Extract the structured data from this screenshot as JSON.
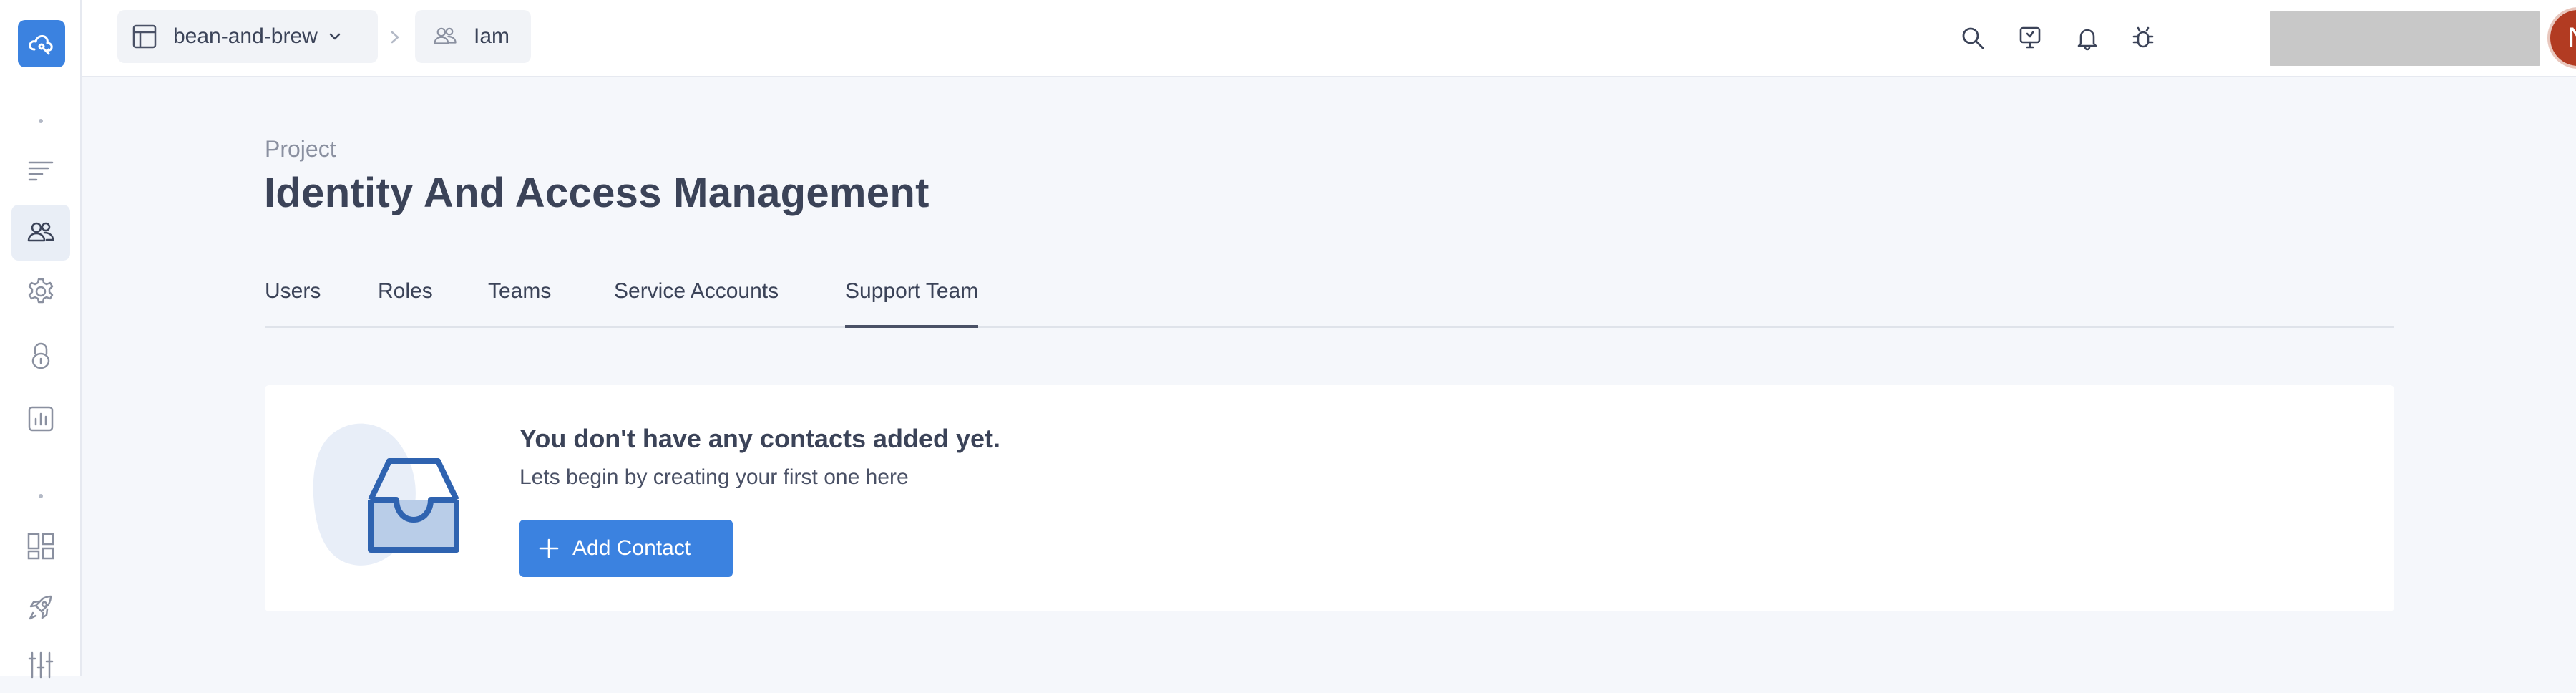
{
  "breadcrumb": {
    "project": "bean-and-brew",
    "section": "Iam"
  },
  "header": {
    "icons": [
      "search-icon",
      "screen-share-icon",
      "bell-icon",
      "bug-icon"
    ],
    "avatar_initial": "N"
  },
  "sidebar": {
    "icons": [
      "logo-icon",
      "list-icon",
      "users-icon",
      "gear-icon",
      "lock-icon",
      "chart-icon",
      "widgets-icon",
      "rocket-icon",
      "sliders-icon"
    ]
  },
  "page": {
    "eyebrow": "Project",
    "title": "Identity And Access Management"
  },
  "tabs": [
    {
      "label": "Users"
    },
    {
      "label": "Roles"
    },
    {
      "label": "Teams"
    },
    {
      "label": "Service Accounts"
    },
    {
      "label": "Support Team",
      "active": true
    }
  ],
  "empty_state": {
    "heading": "You don't have any contacts added yet.",
    "subtext": "Lets begin by creating your first one here",
    "button_label": "Add Contact"
  },
  "colors": {
    "accent": "#3b82e0",
    "avatar": "#b23b22",
    "background": "#f5f7fb"
  }
}
